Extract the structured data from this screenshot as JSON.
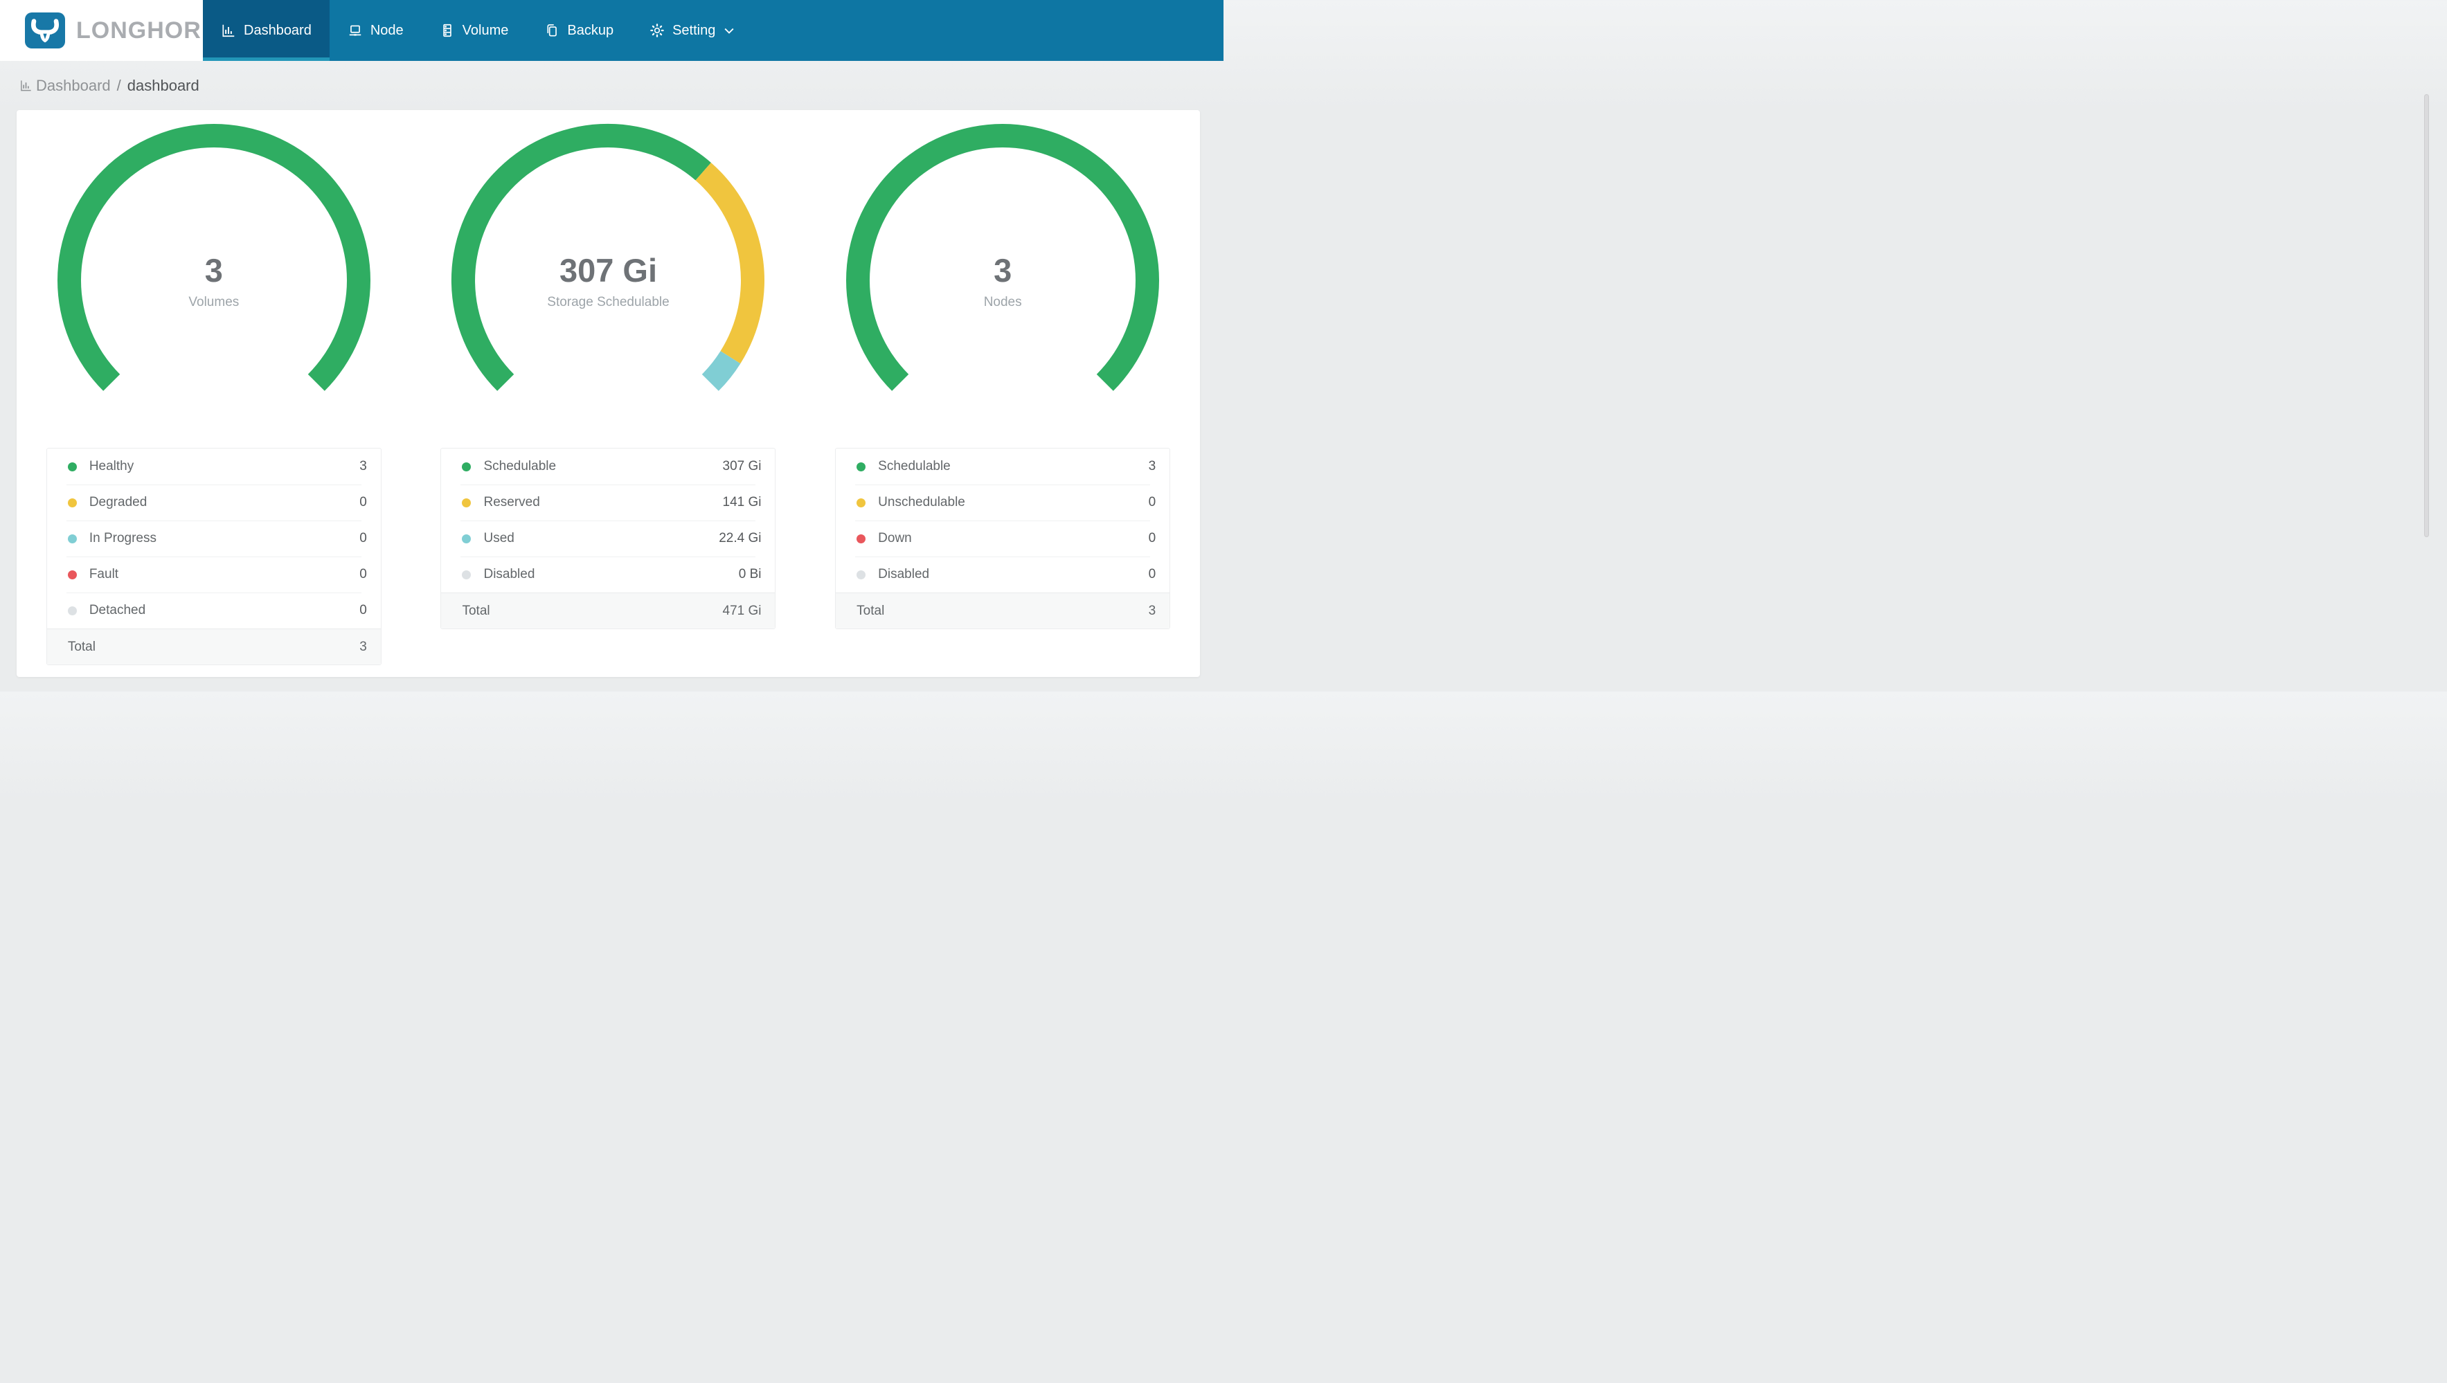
{
  "brand": {
    "name": "LONGHORN"
  },
  "nav": {
    "items": [
      {
        "label": "Dashboard",
        "icon": "bar-chart-icon",
        "active": true
      },
      {
        "label": "Node",
        "icon": "node-icon",
        "active": false
      },
      {
        "label": "Volume",
        "icon": "volume-icon",
        "active": false
      },
      {
        "label": "Backup",
        "icon": "backup-icon",
        "active": false
      },
      {
        "label": "Setting",
        "icon": "gear-icon",
        "active": false,
        "has_dropdown": true
      }
    ]
  },
  "breadcrumb": {
    "section": "Dashboard",
    "separator": "/",
    "page": "dashboard"
  },
  "colors": {
    "header": "#0E76A3",
    "header_active": "#0A5A86",
    "active_underline": "#2296B8",
    "healthy_green": "#2FAD62",
    "warning_yellow": "#F0C53E",
    "progress_teal": "#80CED4",
    "fault_red": "#E9575C",
    "disabled_gray": "#DDE1E4"
  },
  "chart_data": [
    {
      "type": "pie",
      "variant": "gauge-donut",
      "center_value": "3",
      "center_label": "Volumes",
      "arc": {
        "start_deg": -135,
        "span_deg": 270
      },
      "rows": [
        {
          "label": "Healthy",
          "display": "3",
          "value": 3,
          "color": "#2FAD62"
        },
        {
          "label": "Degraded",
          "display": "0",
          "value": 0,
          "color": "#F0C53E"
        },
        {
          "label": "In Progress",
          "display": "0",
          "value": 0,
          "color": "#80CED4"
        },
        {
          "label": "Fault",
          "display": "0",
          "value": 0,
          "color": "#E9575C"
        },
        {
          "label": "Detached",
          "display": "0",
          "value": 0,
          "color": "#DDE1E4"
        }
      ],
      "total_label": "Total",
      "total_value": "3"
    },
    {
      "type": "pie",
      "variant": "gauge-donut",
      "center_value": "307 Gi",
      "center_label": "Storage Schedulable",
      "arc": {
        "start_deg": -135,
        "span_deg": 270
      },
      "rows": [
        {
          "label": "Schedulable",
          "display": "307 Gi",
          "value": 307,
          "color": "#2FAD62"
        },
        {
          "label": "Reserved",
          "display": "141 Gi",
          "value": 141,
          "color": "#F0C53E"
        },
        {
          "label": "Used",
          "display": "22.4 Gi",
          "value": 22.4,
          "color": "#80CED4"
        },
        {
          "label": "Disabled",
          "display": "0 Bi",
          "value": 0,
          "color": "#DDE1E4"
        }
      ],
      "total_label": "Total",
      "total_value": "471 Gi"
    },
    {
      "type": "pie",
      "variant": "gauge-donut",
      "center_value": "3",
      "center_label": "Nodes",
      "arc": {
        "start_deg": -135,
        "span_deg": 270
      },
      "rows": [
        {
          "label": "Schedulable",
          "display": "3",
          "value": 3,
          "color": "#2FAD62"
        },
        {
          "label": "Unschedulable",
          "display": "0",
          "value": 0,
          "color": "#F0C53E"
        },
        {
          "label": "Down",
          "display": "0",
          "value": 0,
          "color": "#E9575C"
        },
        {
          "label": "Disabled",
          "display": "0",
          "value": 0,
          "color": "#DDE1E4"
        }
      ],
      "total_label": "Total",
      "total_value": "3"
    }
  ]
}
